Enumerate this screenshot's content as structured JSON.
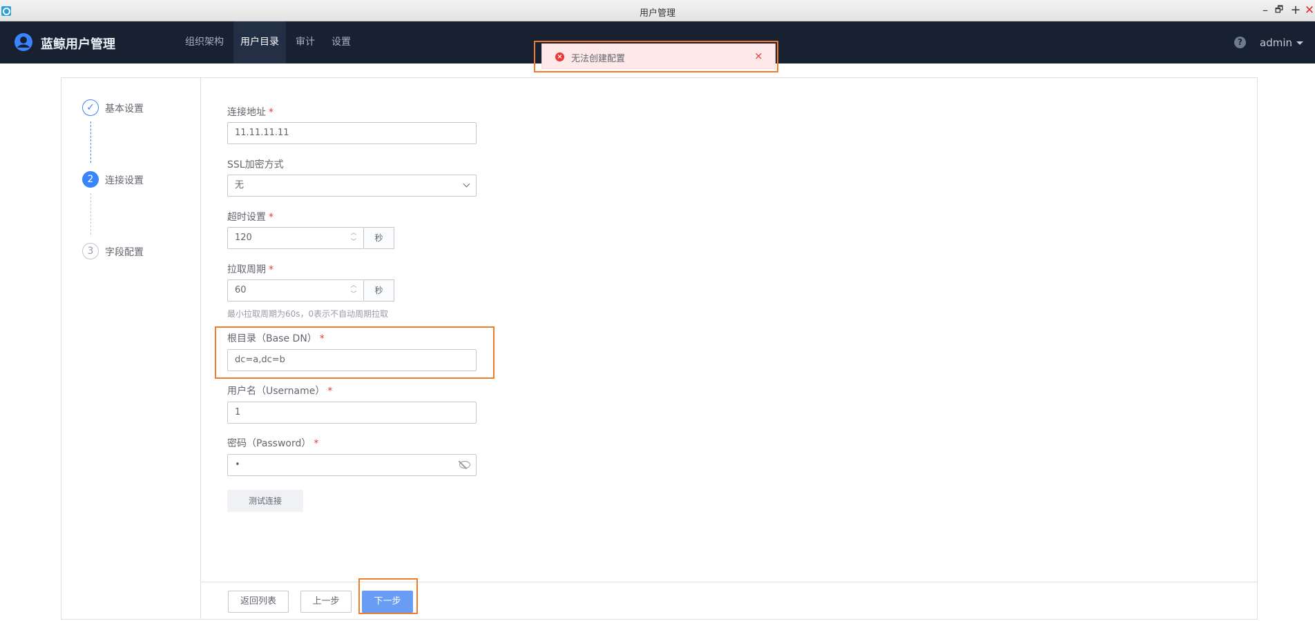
{
  "window": {
    "title": "用户管理",
    "controls": {
      "minimize": "–",
      "maximize": "🗗",
      "plus": "+",
      "close": "✕"
    }
  },
  "header": {
    "brand": "蓝鲸用户管理",
    "nav": [
      {
        "label": "组织架构",
        "active": false
      },
      {
        "label": "用户目录",
        "active": true
      },
      {
        "label": "审计",
        "active": false
      },
      {
        "label": "设置",
        "active": false
      }
    ],
    "help_glyph": "?",
    "user": "admin"
  },
  "toast": {
    "message": "无法创建配置",
    "error_glyph": "×",
    "close_glyph": "×",
    "color": "#ea3636"
  },
  "steps": [
    {
      "index": "✓",
      "label": "基本设置",
      "state": "done"
    },
    {
      "index": "2",
      "label": "连接设置",
      "state": "current"
    },
    {
      "index": "3",
      "label": "字段配置",
      "state": "todo"
    }
  ],
  "form": {
    "address": {
      "label": "连接地址",
      "value": "11.11.11.11"
    },
    "ssl": {
      "label": "SSL加密方式",
      "value": "无"
    },
    "timeout": {
      "label": "超时设置",
      "value": "120",
      "unit": "秒"
    },
    "pull_period": {
      "label": "拉取周期",
      "value": "60",
      "unit": "秒",
      "hint": "最小拉取周期为60s，0表示不自动周期拉取"
    },
    "base_dn": {
      "label": "根目录（Base DN）",
      "value": "dc=a,dc=b"
    },
    "username": {
      "label": "用户名（Username）",
      "value": "1"
    },
    "password": {
      "label": "密码（Password）",
      "value": "•"
    },
    "required_mark": "*",
    "spin_up": "︿",
    "spin_down": "﹀",
    "test_button": "测试连接"
  },
  "footer": {
    "back_to_list": "返回列表",
    "prev": "上一步",
    "next": "下一步"
  },
  "colors": {
    "accent": "#3a84ff",
    "primary_button": "#699df4",
    "nav_bg": "#182132",
    "highlight": "#f27a29"
  }
}
